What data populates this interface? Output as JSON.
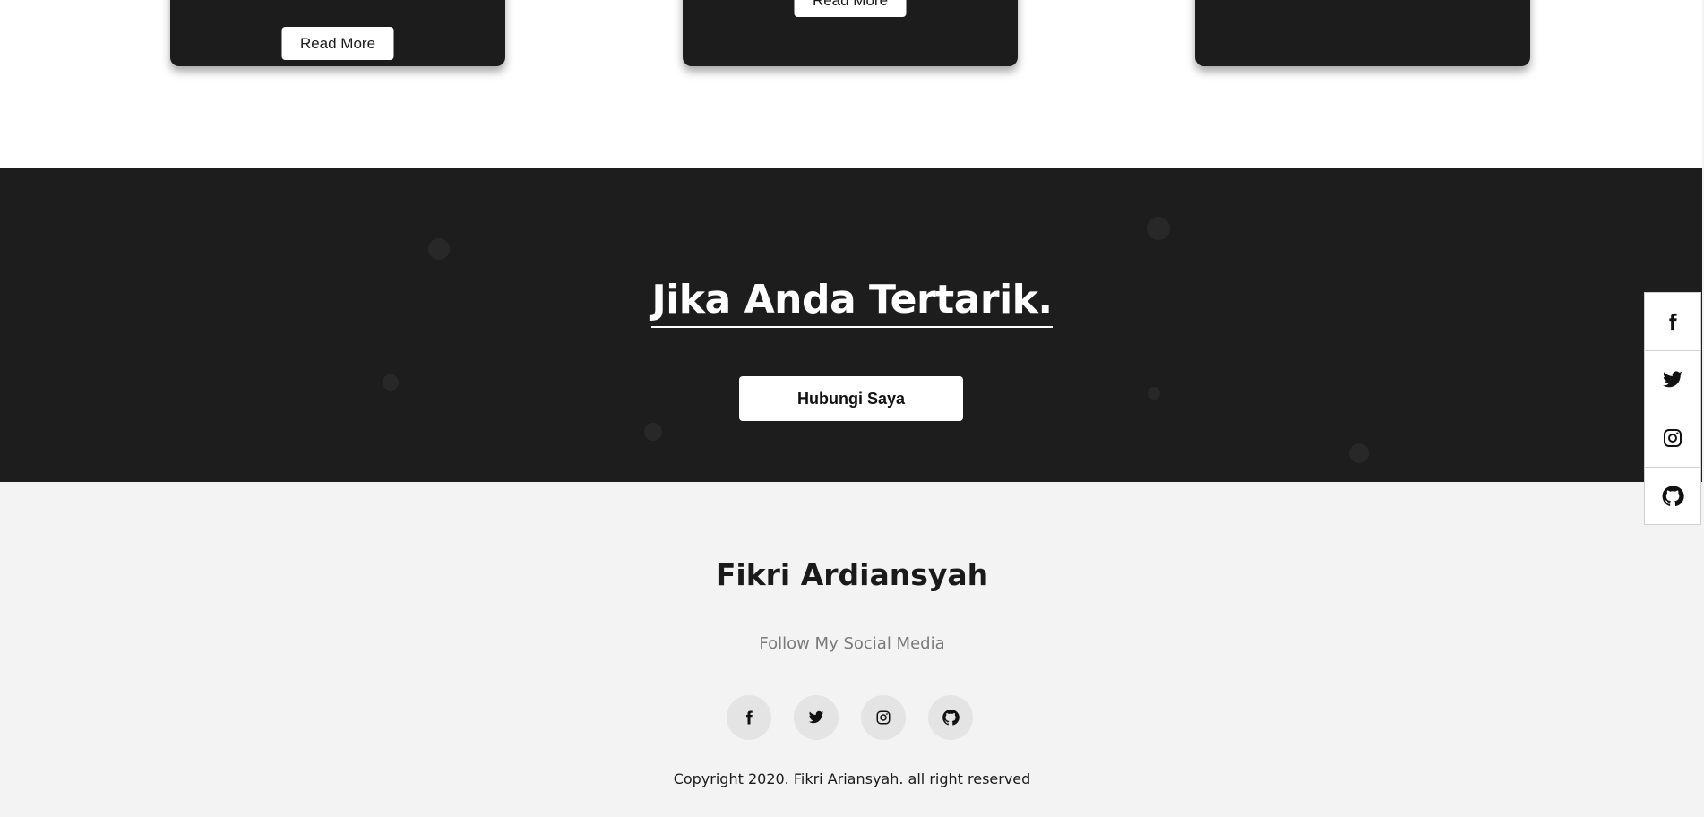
{
  "cards": [
    {
      "button_label": "Read More"
    },
    {
      "button_label": "Read More"
    },
    {
      "button_label": ""
    }
  ],
  "cta": {
    "title": "Jika Anda Tertarik.",
    "button_label": "Hubungi Saya"
  },
  "footer": {
    "name": "Fikri Ardiansyah",
    "follow_text": "Follow My Social Media",
    "social_icons": [
      "facebook-icon",
      "twitter-icon",
      "instagram-icon",
      "github-icon"
    ],
    "copyright": "Copyright 2020. Fikri Ariansyah. all right reserved"
  },
  "side_bar": {
    "icons": [
      "facebook-icon",
      "twitter-icon",
      "instagram-icon",
      "github-icon"
    ]
  },
  "colors": {
    "dark_bg": "#1d1d1d",
    "footer_bg": "#f3f3f3",
    "text_dark": "#1a1a1a",
    "text_muted": "#7a7a7a",
    "icon_circle": "#e4e4e4"
  }
}
